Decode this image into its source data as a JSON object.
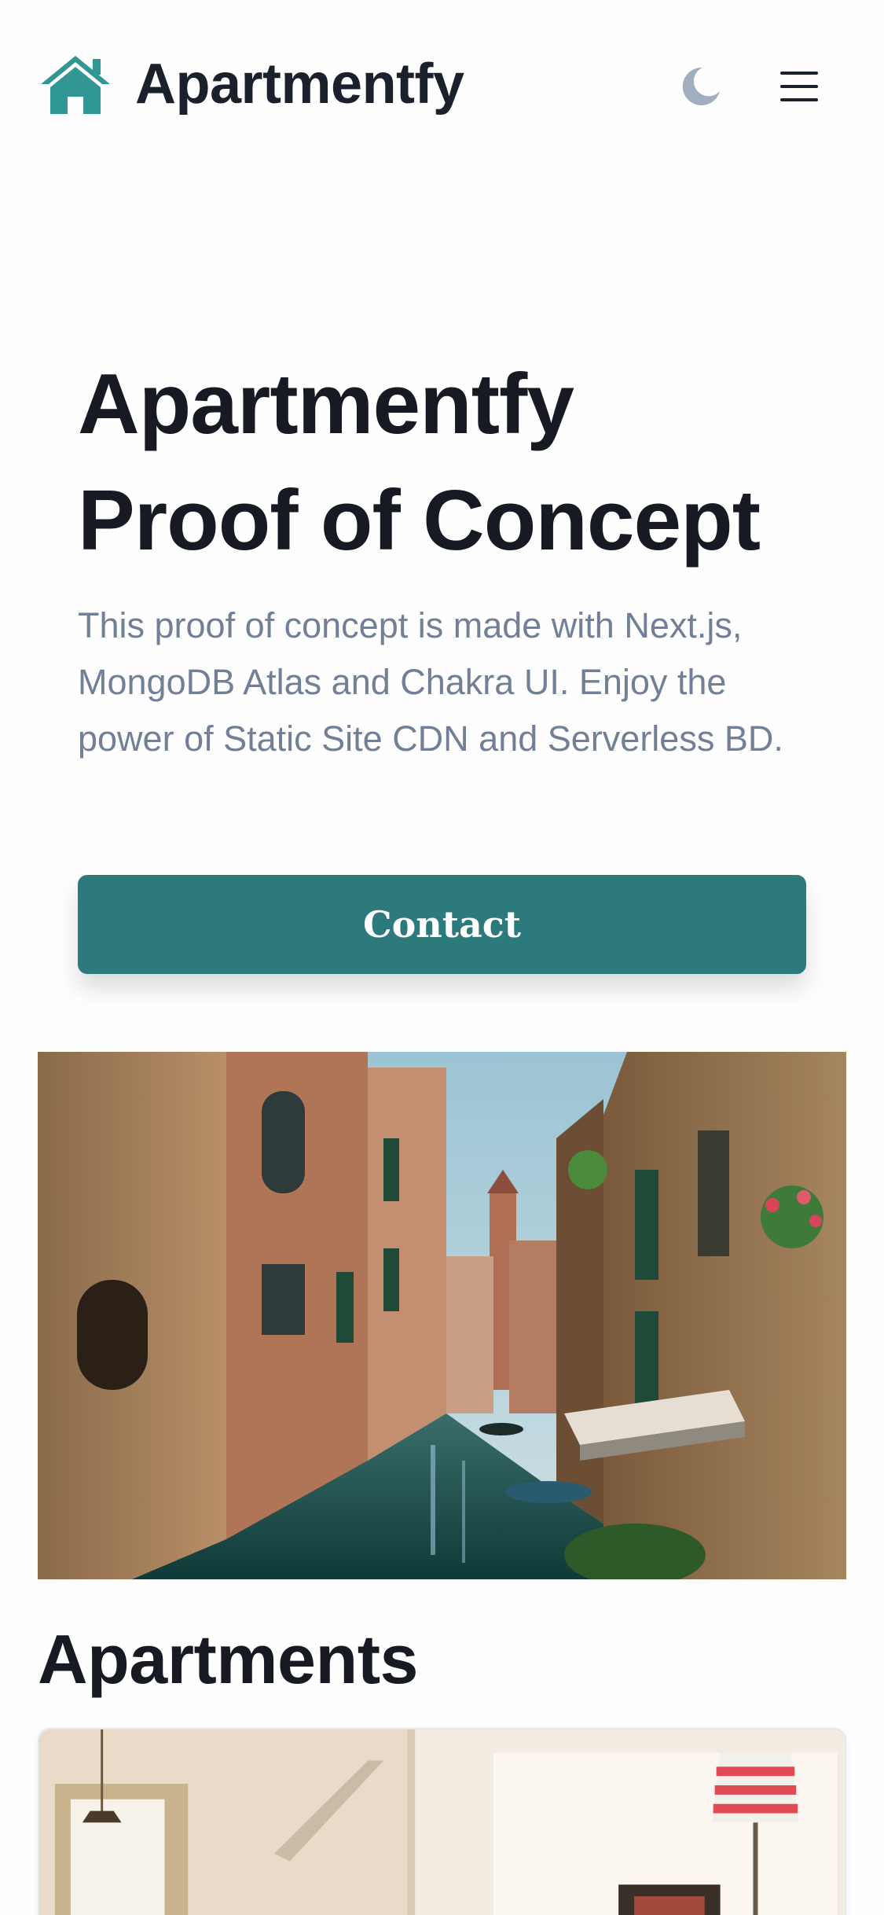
{
  "header": {
    "brand_name": "Apartmentfy",
    "brand_icon": "house-icon",
    "theme_toggle_icon": "moon-icon",
    "menu_icon": "hamburger-menu-icon"
  },
  "hero": {
    "title_line1": "Apartmentfy",
    "title_line2": "Proof of Concept",
    "description": "This proof of concept is made with Next.js, MongoDB Atlas and Chakra UI. Enjoy the power of Static Site CDN and Serverless BD.",
    "contact_label": "Contact"
  },
  "banner": {
    "image": "venice-canal-photo"
  },
  "apartments": {
    "title": "Apartments",
    "card_image": "apartment-interior-photo"
  },
  "colors": {
    "brand_teal": "#319795",
    "button_teal": "#2c7a7b",
    "heading": "#171923",
    "body_text": "#718096",
    "moon_icon": "#a0aec0"
  }
}
